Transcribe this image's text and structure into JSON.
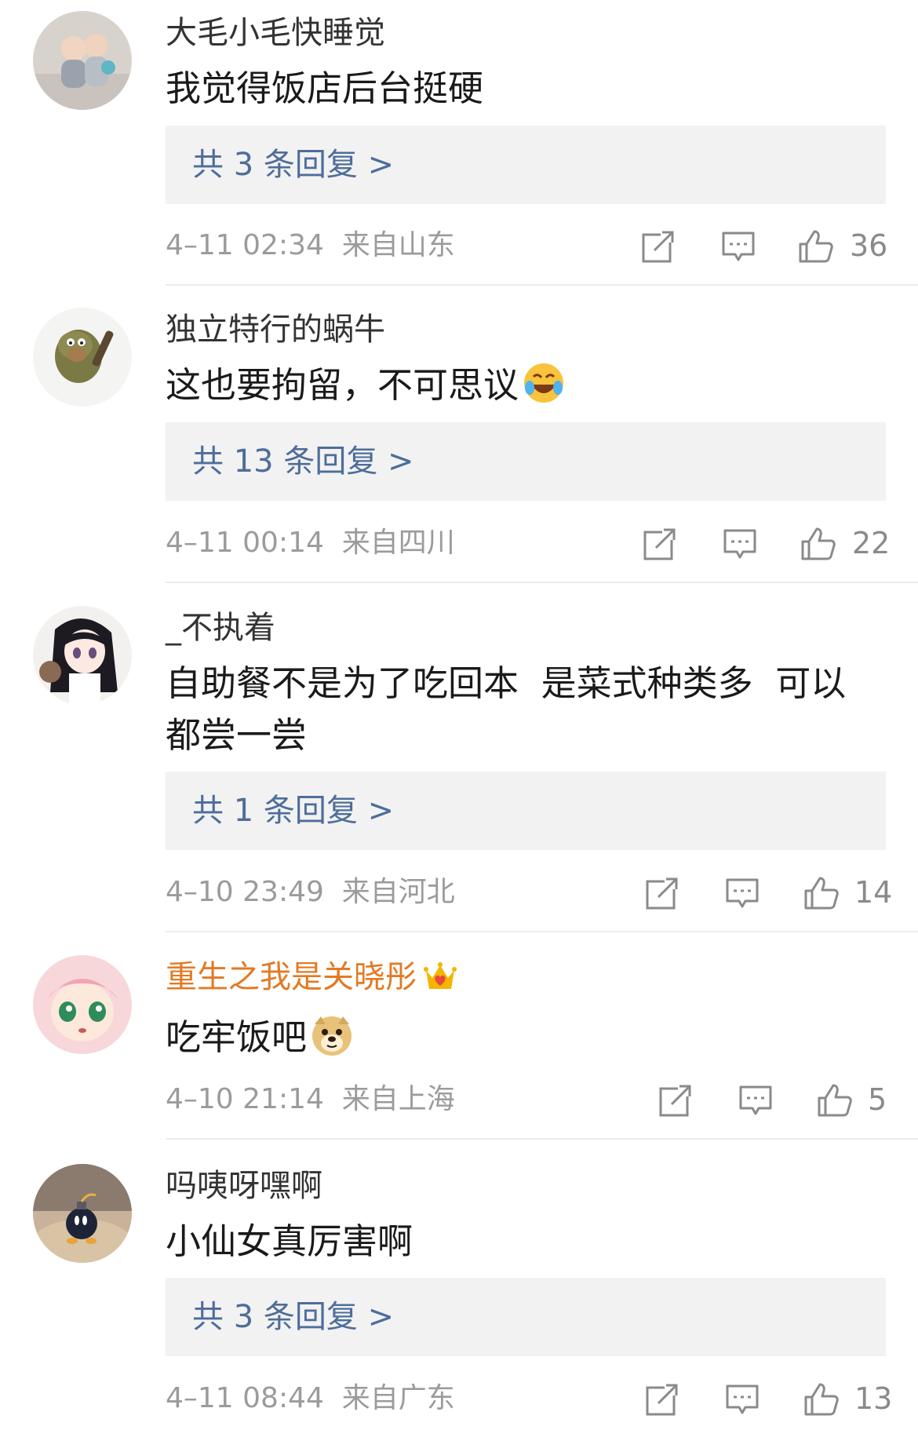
{
  "comments": [
    {
      "username": "大毛小毛快睡觉",
      "text": "我觉得饭店后台挺硬",
      "replies_label": "共 3 条回复 >",
      "time": "4–11 02:34",
      "location": "来自山东",
      "likes": "36",
      "avatar_icon": "baby-photo-avatar"
    },
    {
      "username": "独立特行的蜗牛",
      "text": "这也要拘留，不可思议",
      "emoji": "laugh-cry-emoji",
      "replies_label": "共 13 条回复 >",
      "time": "4–11 00:14",
      "location": "来自四川",
      "likes": "22",
      "avatar_icon": "caveman-cartoon-avatar"
    },
    {
      "username": "_不执着",
      "text": "自助餐不是为了吃回本  是菜式种类多  可以都尝一尝",
      "replies_label": "共 1 条回复 >",
      "time": "4–10 23:49",
      "location": "来自河北",
      "likes": "14",
      "avatar_icon": "anime-girl-avatar"
    },
    {
      "username": "重生之我是关晓彤",
      "vip_icon": "crown-heart-icon",
      "text": "吃牢饭吧",
      "emoji": "doge-emoji",
      "time": "4–10 21:14",
      "location": "来自上海",
      "likes": "5",
      "avatar_icon": "pink-hair-anime-avatar"
    },
    {
      "username": "吗咦呀嘿啊",
      "text": "小仙女真厉害啊",
      "replies_label": "共 3 条回复 >",
      "time": "4–11 08:44",
      "location": "来自广东",
      "likes": "13",
      "avatar_icon": "bomb-character-avatar"
    }
  ],
  "icons": {
    "share": "share-icon",
    "reply": "comment-icon",
    "like": "thumbs-up-icon"
  },
  "colors": {
    "link": "#4e6d9a",
    "vip_name": "#e27a24",
    "meta": "#9b9b9b"
  }
}
